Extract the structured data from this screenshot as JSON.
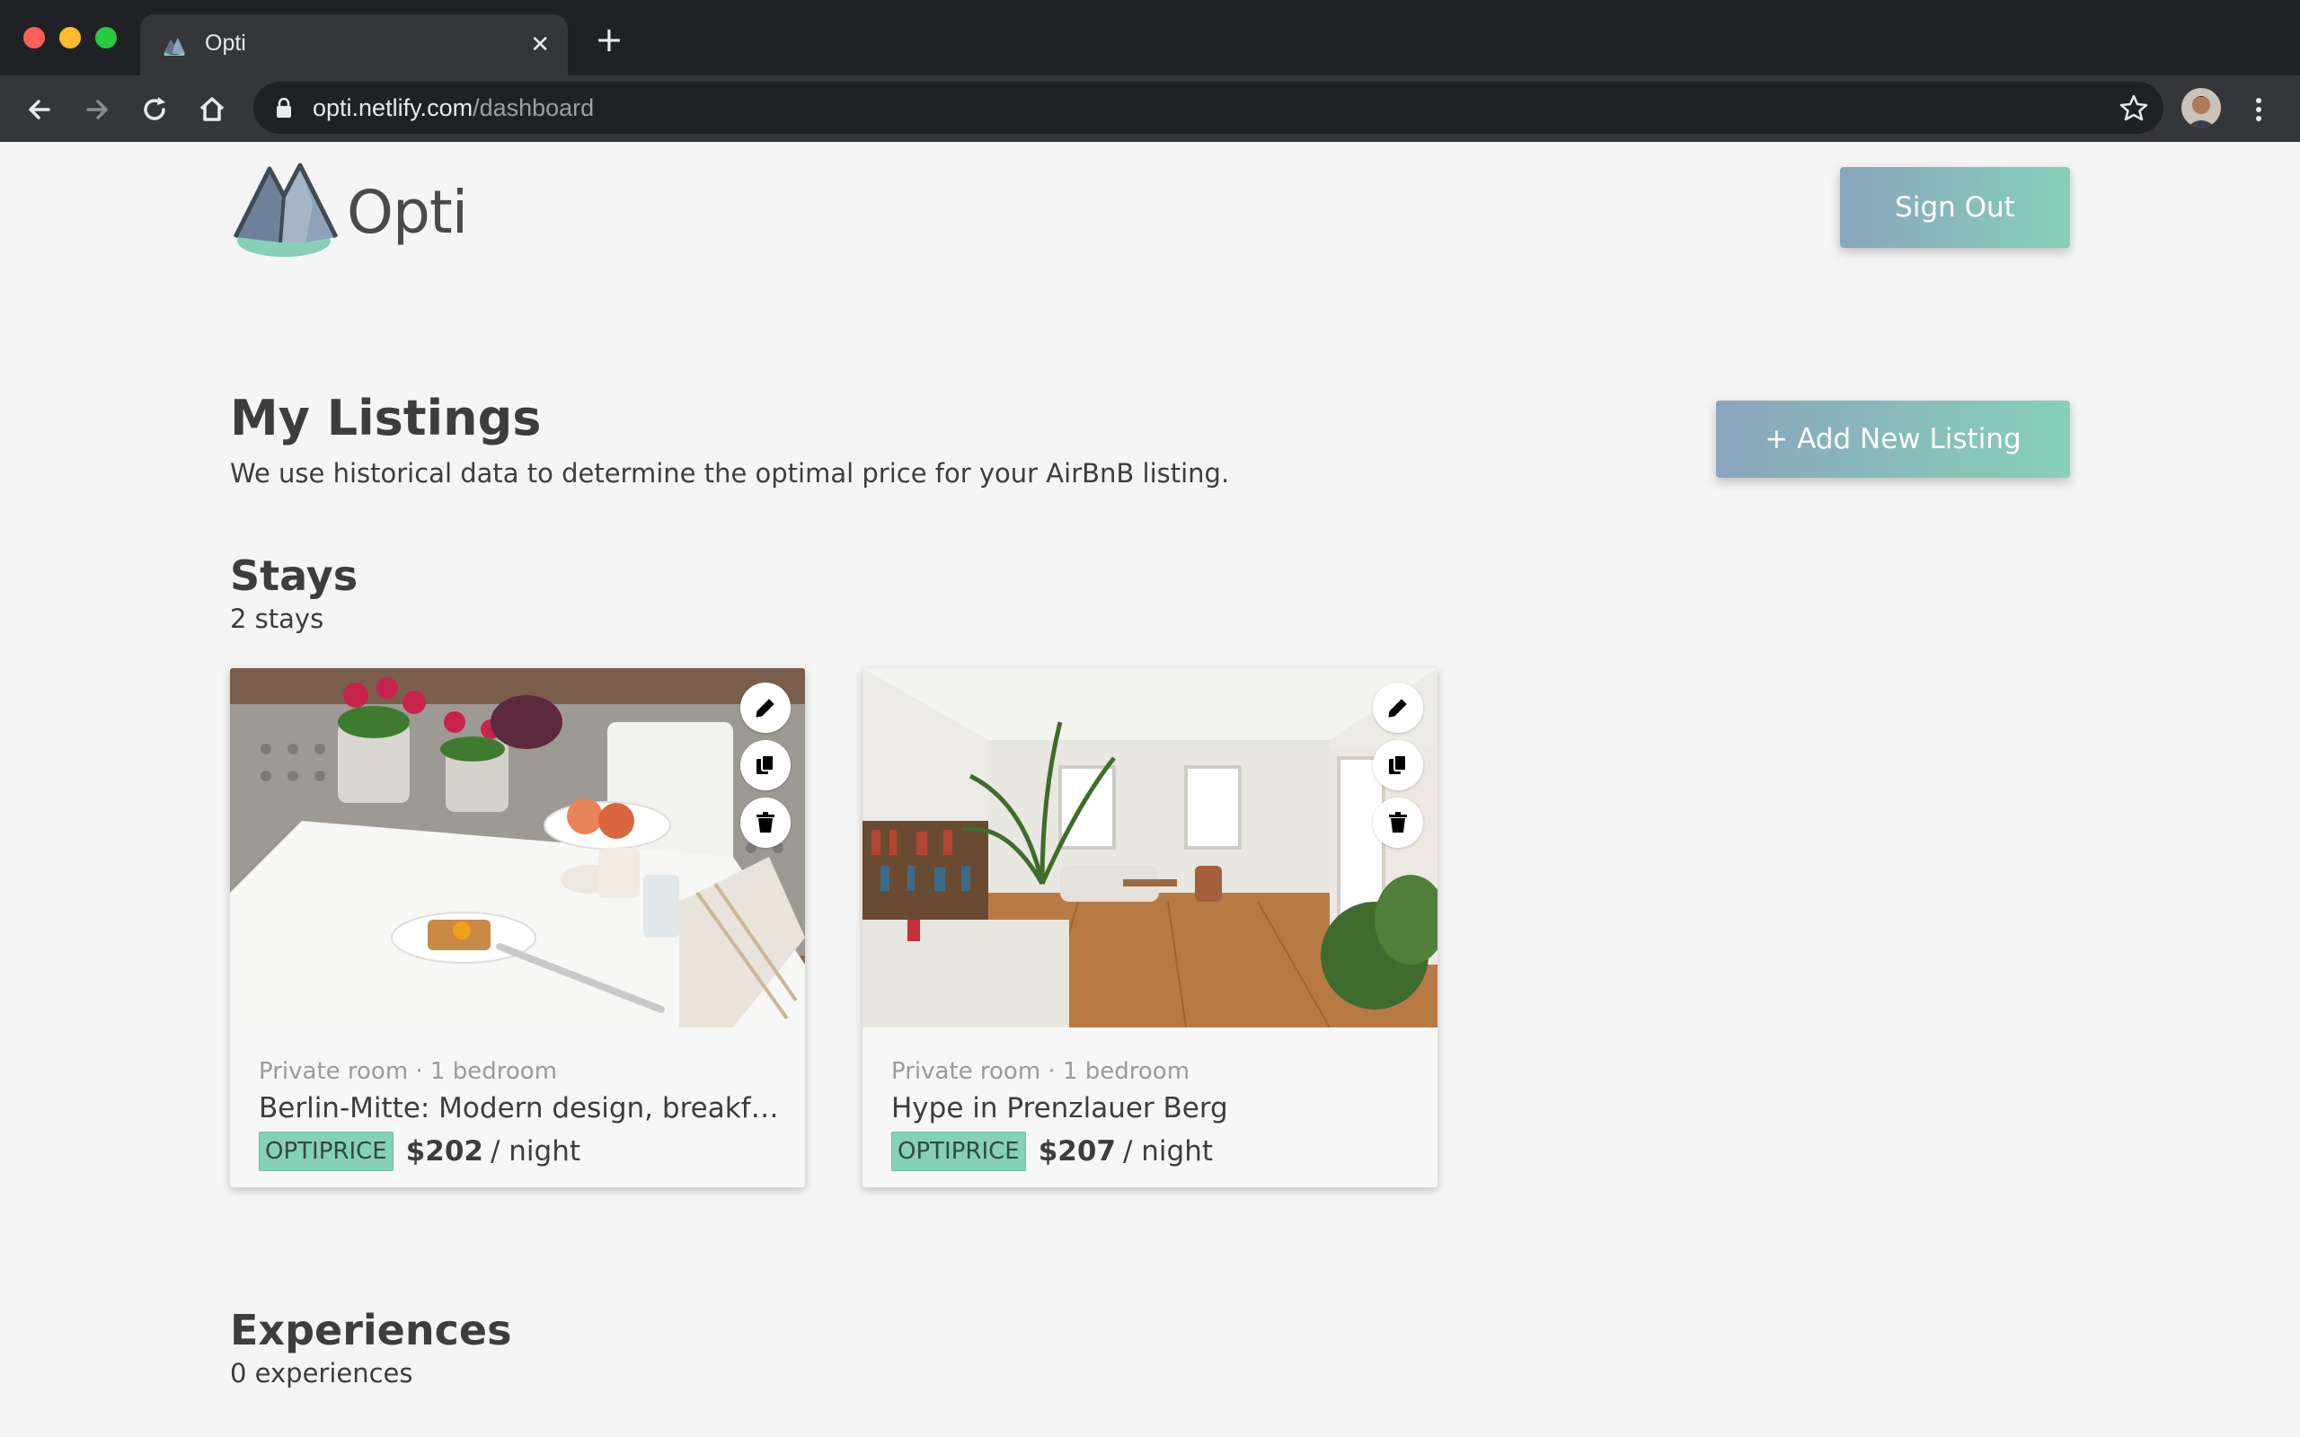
{
  "browser": {
    "tab_title": "Opti",
    "url_host": "opti.netlify.com",
    "url_path": "/dashboard",
    "close_glyph": "✕",
    "new_tab_glyph": "+"
  },
  "header": {
    "logo_text": "Opti",
    "signout_label": "Sign Out"
  },
  "main": {
    "title": "My Listings",
    "subtitle": "We use historical data to determine the optimal price for your AirBnB listing.",
    "add_label": "+ Add New Listing",
    "stays": {
      "heading": "Stays",
      "count": "2 stays",
      "cards": [
        {
          "meta": "Private room · 1 bedroom",
          "title": "Berlin-Mitte: Modern design, breakfa...",
          "badge": "OPTIPRICE",
          "price": "$202",
          "per": "/ night"
        },
        {
          "meta": "Private room · 1 bedroom",
          "title": "Hype in Prenzlauer Berg",
          "badge": "OPTIPRICE",
          "price": "$207",
          "per": "/ night"
        }
      ]
    },
    "experiences": {
      "heading": "Experiences",
      "count": "0 experiences"
    }
  },
  "icons": [
    "back-icon",
    "forward-icon",
    "reload-icon",
    "home-icon",
    "lock-icon",
    "star-icon",
    "kebab-icon",
    "edit-icon",
    "copy-icon",
    "delete-icon"
  ],
  "colors": {
    "accent_start": "#8aa5bc",
    "accent_end": "#86d0b8",
    "badge": "#86d0b8",
    "text": "#3d3d3d"
  }
}
